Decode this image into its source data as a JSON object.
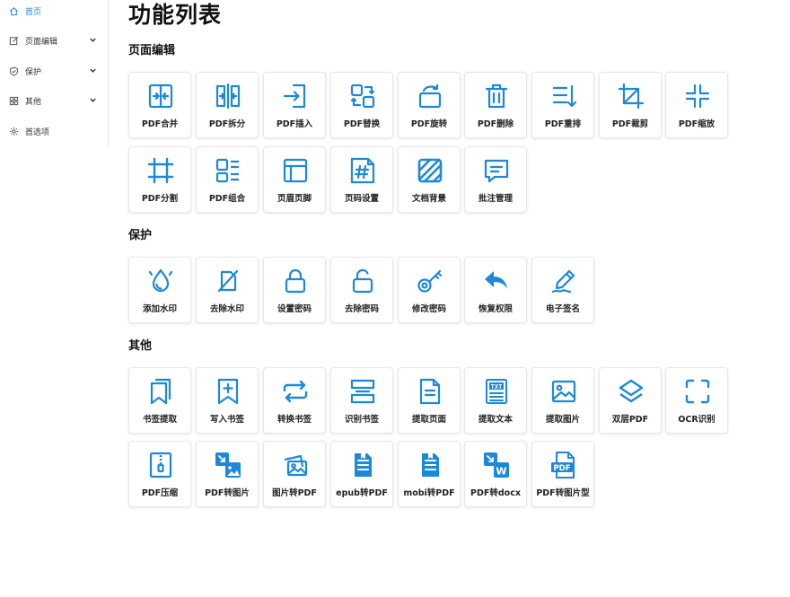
{
  "sidebar": {
    "items": [
      {
        "label": "首页"
      },
      {
        "label": "页面编辑"
      },
      {
        "label": "保护"
      },
      {
        "label": "其他"
      },
      {
        "label": "首选项"
      }
    ]
  },
  "main": {
    "title": "功能列表",
    "sections": [
      {
        "title": "页面编辑",
        "tools": [
          "PDF合并",
          "PDF拆分",
          "PDF插入",
          "PDF替换",
          "PDF旋转",
          "PDF删除",
          "PDF重排",
          "PDF裁剪",
          "PDF缩放",
          "PDF分割",
          "PDF组合",
          "页眉页脚",
          "页码设置",
          "文档背景",
          "批注管理"
        ]
      },
      {
        "title": "保护",
        "tools": [
          "添加水印",
          "去除水印",
          "设置密码",
          "去除密码",
          "修改密码",
          "恢复权限",
          "电子签名"
        ]
      },
      {
        "title": "其他",
        "tools": [
          "书签提取",
          "写入书签",
          "转换书签",
          "识别书签",
          "提取页面",
          "提取文本",
          "提取图片",
          "双层PDF",
          "OCR识别",
          "PDF压缩",
          "PDF转图片",
          "图片转PDF",
          "epub转PDF",
          "mobi转PDF",
          "PDF转docx",
          "PDF转图片型"
        ]
      }
    ]
  },
  "colors": {
    "accent": "#1e88d8",
    "card_border": "#e6e8eb"
  }
}
